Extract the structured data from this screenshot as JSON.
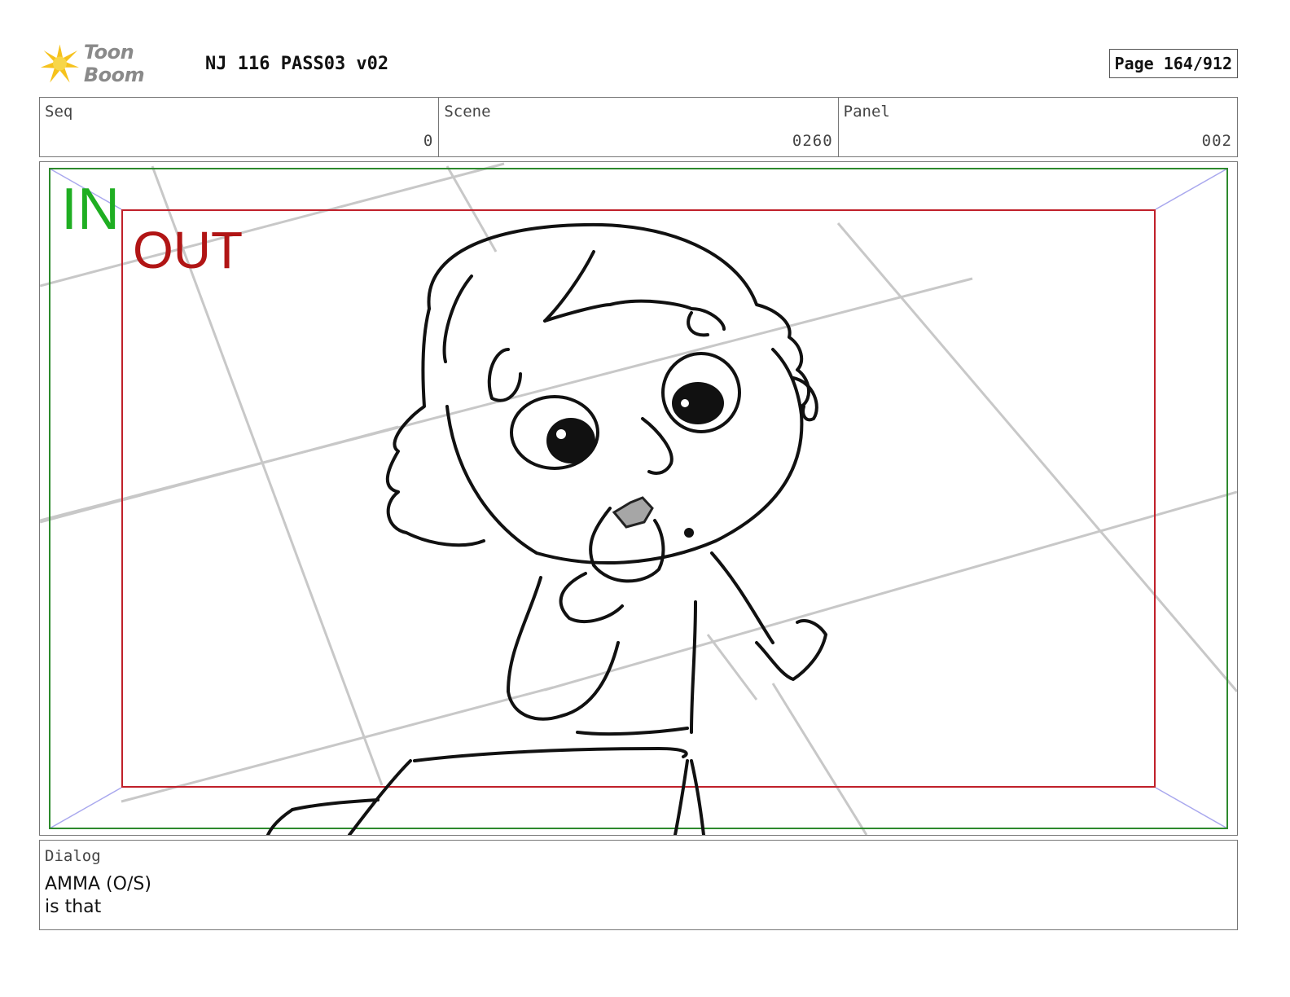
{
  "header": {
    "logo_text": "Toon Boom",
    "project_title": "NJ 116 PASS03 v02",
    "page_label": "Page 164/912"
  },
  "info": {
    "seq": {
      "label": "Seq",
      "value": "0"
    },
    "scene": {
      "label": "Scene",
      "value": "0260"
    },
    "panel": {
      "label": "Panel",
      "value": "002"
    }
  },
  "frame": {
    "in_label": "IN",
    "out_label": "OUT",
    "in_color": "#1fae22",
    "out_color": "#b11515"
  },
  "dialog": {
    "label": "Dialog",
    "lines": [
      "AMMA (O/S)",
      "is that"
    ]
  }
}
